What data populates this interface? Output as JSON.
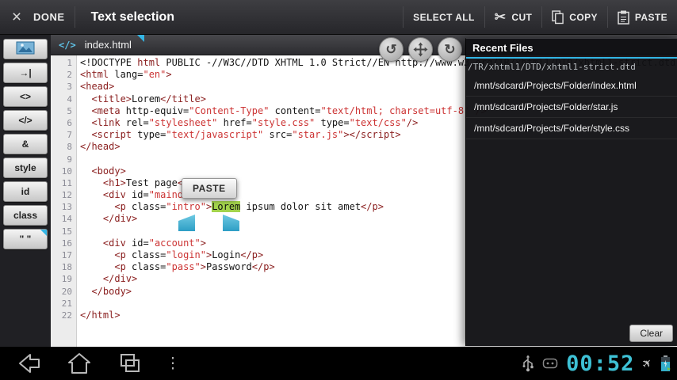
{
  "icons": {
    "close": "×",
    "scissors": "✂",
    "undo": "↺",
    "redo": "↻",
    "code_tab": "</>",
    "plane": "✈",
    "overflow_menu": "⋮"
  },
  "colors": {
    "accent": "#33B5E5",
    "selection_green": "#A3D34C",
    "tag": "#8B2020",
    "string": "#CC3333",
    "clock": "#3EC1D5"
  },
  "top_bar": {
    "done_label": "DONE",
    "title": "Text selection",
    "actions": [
      {
        "name": "select-all",
        "label": "SELECT ALL",
        "icon": ""
      },
      {
        "name": "cut",
        "label": "CUT",
        "icon": "scissors"
      },
      {
        "name": "copy",
        "label": "COPY",
        "icon": "copy"
      },
      {
        "name": "paste",
        "label": "PASTE",
        "icon": "paste"
      }
    ]
  },
  "editor": {
    "tab": {
      "filename": "index.html"
    },
    "paste_popup_label": "PASTE",
    "sidebar_buttons": [
      {
        "name": "image-tool",
        "icon": "image",
        "label": ""
      },
      {
        "name": "tab-key",
        "label": "→|"
      },
      {
        "name": "tag-brackets",
        "label": "<>"
      },
      {
        "name": "closing-tag",
        "label": "</>"
      },
      {
        "name": "ampersand",
        "label": "&"
      },
      {
        "name": "style",
        "label": "style"
      },
      {
        "name": "id",
        "label": "id"
      },
      {
        "name": "class",
        "label": "class"
      },
      {
        "name": "quotes",
        "label": "\" \"",
        "corner": true
      }
    ],
    "lines": [
      [
        [
          "p",
          "<!DOCTYPE "
        ],
        [
          "k",
          "html"
        ],
        [
          "p",
          " PUBLIC -//W3C//DTD XHTML 1.0 Strict//EN http://www.w3.org/TR/xhtml1/DTD/xhtml1-strict.dtd"
        ]
      ],
      [
        [
          "k",
          "<html"
        ],
        [
          "p",
          " lang="
        ],
        [
          "s",
          "\"en\""
        ],
        [
          "k",
          ">"
        ]
      ],
      [
        [
          "k",
          "<head>"
        ]
      ],
      [
        [
          "p",
          "  "
        ],
        [
          "k",
          "<title>"
        ],
        [
          "p",
          "Lorem"
        ],
        [
          "k",
          "</title>"
        ]
      ],
      [
        [
          "p",
          "  "
        ],
        [
          "k",
          "<meta"
        ],
        [
          "p",
          " http-equiv="
        ],
        [
          "s",
          "\"Content-Type\""
        ],
        [
          "p",
          " content="
        ],
        [
          "s",
          "\"text/html; charset=utf-8\""
        ],
        [
          "k",
          " />"
        ]
      ],
      [
        [
          "p",
          "  "
        ],
        [
          "k",
          "<link"
        ],
        [
          "p",
          " rel="
        ],
        [
          "s",
          "\"stylesheet\""
        ],
        [
          "p",
          " href="
        ],
        [
          "s",
          "\"style.css\""
        ],
        [
          "p",
          " type="
        ],
        [
          "s",
          "\"text/css\""
        ],
        [
          "k",
          "/>"
        ]
      ],
      [
        [
          "p",
          "  "
        ],
        [
          "k",
          "<script"
        ],
        [
          "p",
          " type="
        ],
        [
          "s",
          "\"text/javascript\""
        ],
        [
          "p",
          " src="
        ],
        [
          "s",
          "\"star.js\""
        ],
        [
          "k",
          "></script>"
        ]
      ],
      [
        [
          "k",
          "</head>"
        ]
      ],
      [],
      [
        [
          "p",
          "  "
        ],
        [
          "k",
          "<body>"
        ]
      ],
      [
        [
          "p",
          "    "
        ],
        [
          "k",
          "<h1>"
        ],
        [
          "p",
          "Test page"
        ],
        [
          "k",
          "</h1>"
        ]
      ],
      [
        [
          "p",
          "    "
        ],
        [
          "k",
          "<div"
        ],
        [
          "p",
          " id="
        ],
        [
          "s",
          "\"maindiv\""
        ],
        [
          "k",
          ">"
        ]
      ],
      [
        [
          "p",
          "      "
        ],
        [
          "k",
          "<p"
        ],
        [
          "p",
          " class="
        ],
        [
          "s",
          "\"intro\""
        ],
        [
          "k",
          ">"
        ],
        [
          "g",
          "Lorem"
        ],
        [
          "p",
          " ipsum dolor sit amet"
        ],
        [
          "k",
          "</p>"
        ]
      ],
      [
        [
          "p",
          "    "
        ],
        [
          "k",
          "</div>"
        ]
      ],
      [],
      [
        [
          "p",
          "    "
        ],
        [
          "k",
          "<div"
        ],
        [
          "p",
          " id="
        ],
        [
          "s",
          "\"account\""
        ],
        [
          "k",
          ">"
        ]
      ],
      [
        [
          "p",
          "      "
        ],
        [
          "k",
          "<p"
        ],
        [
          "p",
          " class="
        ],
        [
          "s",
          "\"login\""
        ],
        [
          "k",
          ">"
        ],
        [
          "p",
          "Login"
        ],
        [
          "k",
          "</p>"
        ]
      ],
      [
        [
          "p",
          "      "
        ],
        [
          "k",
          "<p"
        ],
        [
          "p",
          " class="
        ],
        [
          "s",
          "\"pass\""
        ],
        [
          "k",
          ">"
        ],
        [
          "p",
          "Password"
        ],
        [
          "k",
          "</p>"
        ]
      ],
      [
        [
          "p",
          "    "
        ],
        [
          "k",
          "</div>"
        ]
      ],
      [
        [
          "p",
          "  "
        ],
        [
          "k",
          "</body>"
        ]
      ],
      [],
      [
        [
          "k",
          "</html>"
        ]
      ]
    ]
  },
  "recent_files": {
    "title": "Recent Files",
    "overlay_text": "/TR/xhtml1/DTD/xhtml1-strict.dtd",
    "files": [
      "/mnt/sdcard/Projects/Folder/index.html",
      "/mnt/sdcard/Projects/Folder/star.js",
      "/mnt/sdcard/Projects/Folder/style.css"
    ],
    "clear_label": "Clear"
  },
  "system_bar": {
    "clock": "00:52"
  }
}
